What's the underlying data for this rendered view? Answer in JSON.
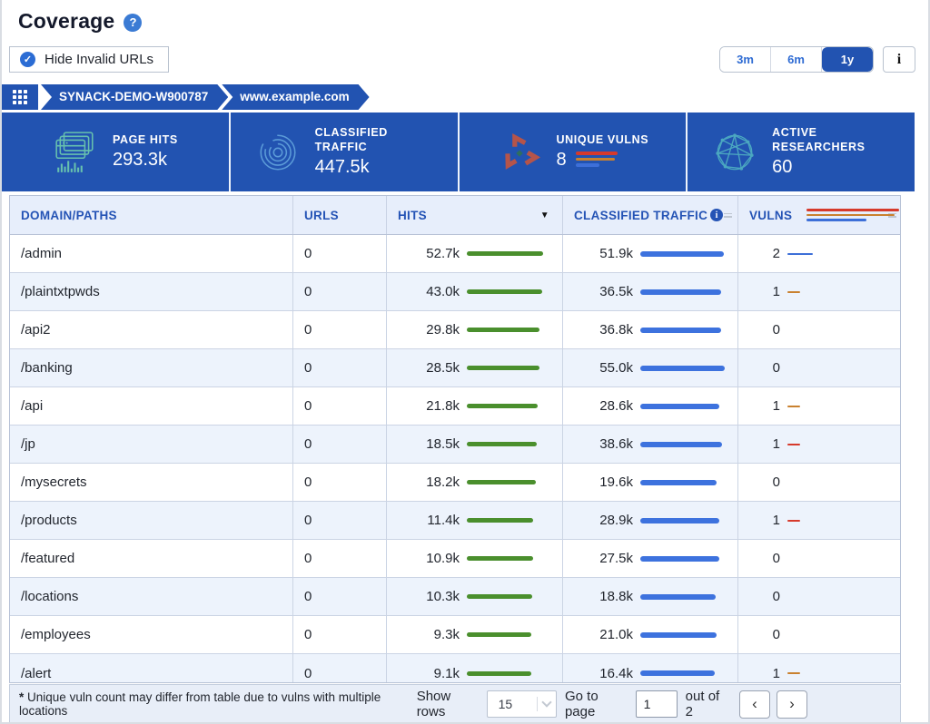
{
  "page": {
    "title": "Coverage"
  },
  "icons": {
    "help": "?",
    "check": "✓",
    "info": "i",
    "sort_desc": "▼",
    "prev": "‹",
    "next": "›"
  },
  "controls": {
    "hide_invalid": {
      "label": "Hide Invalid URLs",
      "checked": true
    },
    "time_ranges": [
      {
        "label": "3m",
        "selected": false
      },
      {
        "label": "6m",
        "selected": false
      },
      {
        "label": "1y",
        "selected": true
      }
    ]
  },
  "breadcrumb": {
    "segments": [
      {
        "label": "SYNACK-DEMO-W900787"
      },
      {
        "label": "www.example.com"
      }
    ]
  },
  "stats": [
    {
      "icon": "page-hits-icon",
      "label": "PAGE HITS",
      "value": "293.3k"
    },
    {
      "icon": "classified-traffic-icon",
      "label": "CLASSIFIED TRAFFIC",
      "value": "447.5k"
    },
    {
      "icon": "unique-vulns-icon",
      "label": "UNIQUE VULNS",
      "value": "8"
    },
    {
      "icon": "active-researchers-icon",
      "label": "ACTIVE RESEARCHERS",
      "value": "60"
    }
  ],
  "table": {
    "columns": [
      "DOMAIN/PATHS",
      "URLS",
      "HITS",
      "CLASSIFIED TRAFFIC",
      "VULNS"
    ],
    "rows": [
      {
        "path": "/admin",
        "urls": "0",
        "hits": "52.7k",
        "hits_value": 52700,
        "traffic": "51.9k",
        "traffic_value": 51900,
        "vulns": "2",
        "vulns_value": 2,
        "vuln_color": "blue"
      },
      {
        "path": "/plaintxtpwds",
        "urls": "0",
        "hits": "43.0k",
        "hits_value": 43000,
        "traffic": "36.5k",
        "traffic_value": 36500,
        "vulns": "1",
        "vulns_value": 1,
        "vuln_color": "orange"
      },
      {
        "path": "/api2",
        "urls": "0",
        "hits": "29.8k",
        "hits_value": 29800,
        "traffic": "36.8k",
        "traffic_value": 36800,
        "vulns": "0",
        "vulns_value": 0,
        "vuln_color": null
      },
      {
        "path": "/banking",
        "urls": "0",
        "hits": "28.5k",
        "hits_value": 28500,
        "traffic": "55.0k",
        "traffic_value": 55000,
        "vulns": "0",
        "vulns_value": 0,
        "vuln_color": null
      },
      {
        "path": "/api",
        "urls": "0",
        "hits": "21.8k",
        "hits_value": 21800,
        "traffic": "28.6k",
        "traffic_value": 28600,
        "vulns": "1",
        "vulns_value": 1,
        "vuln_color": "orange"
      },
      {
        "path": "/jp",
        "urls": "0",
        "hits": "18.5k",
        "hits_value": 18500,
        "traffic": "38.6k",
        "traffic_value": 38600,
        "vulns": "1",
        "vulns_value": 1,
        "vuln_color": "red"
      },
      {
        "path": "/mysecrets",
        "urls": "0",
        "hits": "18.2k",
        "hits_value": 18200,
        "traffic": "19.6k",
        "traffic_value": 19600,
        "vulns": "0",
        "vulns_value": 0,
        "vuln_color": null
      },
      {
        "path": "/products",
        "urls": "0",
        "hits": "11.4k",
        "hits_value": 11400,
        "traffic": "28.9k",
        "traffic_value": 28900,
        "vulns": "1",
        "vulns_value": 1,
        "vuln_color": "red"
      },
      {
        "path": "/featured",
        "urls": "0",
        "hits": "10.9k",
        "hits_value": 10900,
        "traffic": "27.5k",
        "traffic_value": 27500,
        "vulns": "0",
        "vulns_value": 0,
        "vuln_color": null
      },
      {
        "path": "/locations",
        "urls": "0",
        "hits": "10.3k",
        "hits_value": 10300,
        "traffic": "18.8k",
        "traffic_value": 18800,
        "vulns": "0",
        "vulns_value": 0,
        "vuln_color": null
      },
      {
        "path": "/employees",
        "urls": "0",
        "hits": "9.3k",
        "hits_value": 9300,
        "traffic": "21.0k",
        "traffic_value": 21000,
        "vulns": "0",
        "vulns_value": 0,
        "vuln_color": null
      },
      {
        "path": "/alert",
        "urls": "0",
        "hits": "9.1k",
        "hits_value": 9100,
        "traffic": "16.4k",
        "traffic_value": 16400,
        "vulns": "1",
        "vulns_value": 1,
        "vuln_color": "orange"
      }
    ]
  },
  "footer": {
    "note_star": "*",
    "note": "Unique vuln count may differ from table due to vulns with multiple locations",
    "show_rows_label": "Show rows",
    "rows_per_page": "15",
    "goto_label": "Go to page",
    "page_value": "1",
    "total_label": "out of 2"
  },
  "colors": {
    "brand_blue": "#2253b1",
    "hits_bar": "#4a8f2d",
    "traffic_bar": "#3d72de",
    "vuln_red": "#d63a2c",
    "vuln_orange": "#c9812f",
    "vuln_blue": "#3d6fd8"
  }
}
